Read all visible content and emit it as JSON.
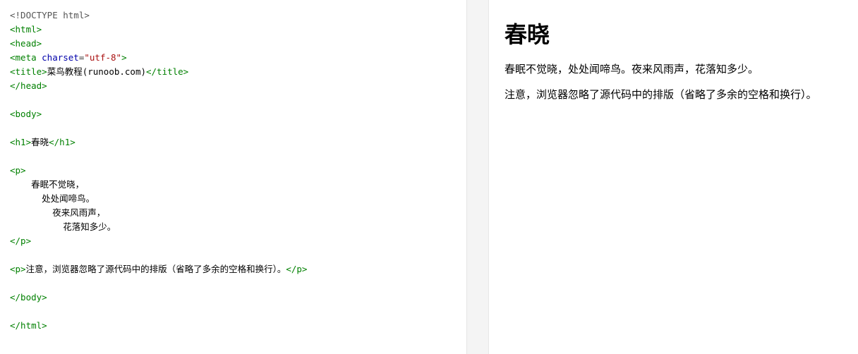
{
  "code_editor": {
    "lines": [
      [
        {
          "cls": "doctype",
          "text": "<!DOCTYPE html>"
        }
      ],
      [
        {
          "cls": "tag",
          "text": "<html>"
        }
      ],
      [
        {
          "cls": "tag",
          "text": "<head>"
        }
      ],
      [
        {
          "cls": "tag",
          "text": "<meta "
        },
        {
          "cls": "attr-name",
          "text": "charset"
        },
        {
          "cls": "punct",
          "text": "="
        },
        {
          "cls": "attr-value",
          "text": "\"utf-8\""
        },
        {
          "cls": "tag",
          "text": ">"
        }
      ],
      [
        {
          "cls": "tag",
          "text": "<title>"
        },
        {
          "cls": "text",
          "text": "菜鸟教程(runoob.com)"
        },
        {
          "cls": "tag",
          "text": "</title>"
        }
      ],
      [
        {
          "cls": "tag",
          "text": "</head>"
        }
      ],
      [],
      [
        {
          "cls": "tag",
          "text": "<body>"
        }
      ],
      [],
      [
        {
          "cls": "tag",
          "text": "<h1>"
        },
        {
          "cls": "text",
          "text": "春晓"
        },
        {
          "cls": "tag",
          "text": "</h1>"
        }
      ],
      [],
      [
        {
          "cls": "tag",
          "text": "<p>"
        }
      ],
      [
        {
          "cls": "text",
          "text": "    春眠不觉晓，"
        }
      ],
      [
        {
          "cls": "text",
          "text": "      处处闻啼鸟。"
        }
      ],
      [
        {
          "cls": "text",
          "text": "        夜来风雨声，"
        }
      ],
      [
        {
          "cls": "text",
          "text": "          花落知多少。"
        }
      ],
      [
        {
          "cls": "tag",
          "text": "</p>"
        }
      ],
      [],
      [
        {
          "cls": "tag",
          "text": "<p>"
        },
        {
          "cls": "text",
          "text": "注意，浏览器忽略了源代码中的排版（省略了多余的空格和换行）。"
        },
        {
          "cls": "tag",
          "text": "</p>"
        }
      ],
      [],
      [
        {
          "cls": "tag",
          "text": "</body>"
        }
      ],
      [],
      [
        {
          "cls": "tag",
          "text": "</html>"
        }
      ]
    ]
  },
  "preview": {
    "title": "春晓",
    "paragraphs": [
      "春眠不觉晓，处处闻啼鸟。夜来风雨声，花落知多少。",
      "注意，浏览器忽略了源代码中的排版（省略了多余的空格和换行）。"
    ]
  }
}
